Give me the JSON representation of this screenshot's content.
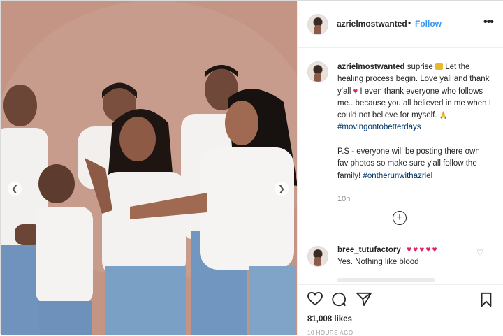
{
  "post": {
    "username": "azrielmostwanted",
    "follow_separator": "•",
    "follow_label": "Follow",
    "more_icon": "more-options-icon",
    "caption": {
      "username": "azrielmostwanted",
      "part1": "suprise",
      "part2": "Let the healing process begin. Love yall and thank y'all",
      "part3": "I even thank everyone who follows me.. because you all believed in me when I could not believe for myself.",
      "hashtag1": "#movingontobetterdays",
      "ps": "P.S - everyone will be posting there own fav photos so make sure y'all follow the family!",
      "hashtag2": "#ontherunwithazriel"
    },
    "time": "10h",
    "comment": {
      "username": "bree_tutufactory",
      "hearts": "♥♥♥♥♥",
      "text": "Yes. Nothing like blood"
    },
    "likes": "81,008 likes",
    "posted_ago": "10 HOURS AGO"
  },
  "colors": {
    "link": "#3897f0",
    "hashtag": "#003569",
    "heart": "#e0245e",
    "backdrop": "#c19383"
  }
}
